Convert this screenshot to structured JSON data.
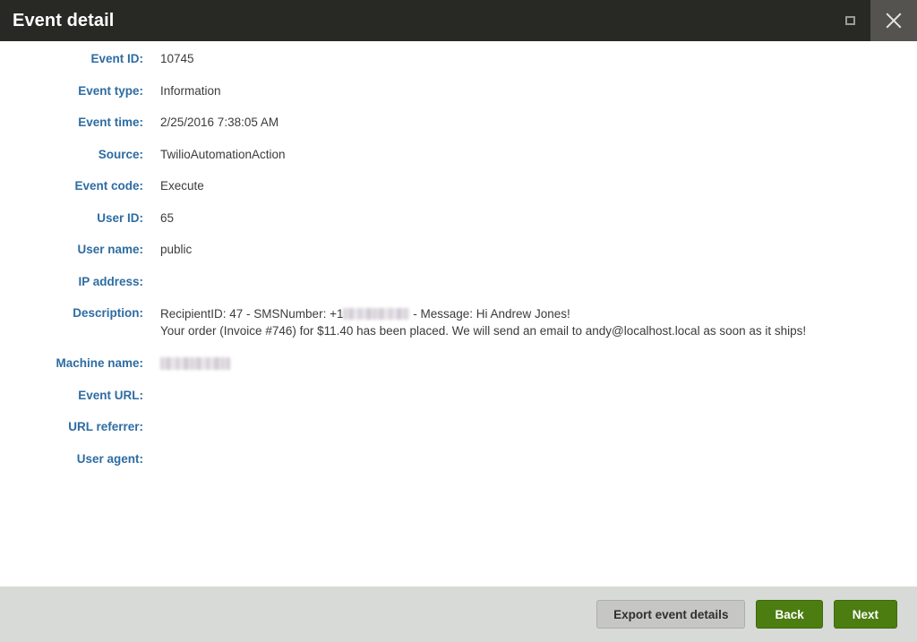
{
  "titlebar": {
    "title": "Event detail",
    "restore_icon": "restore-window-icon",
    "close_icon": "close-icon"
  },
  "fields": [
    {
      "label": "Event ID:",
      "value": "10745"
    },
    {
      "label": "Event type:",
      "value": "Information"
    },
    {
      "label": "Event time:",
      "value": "2/25/2016 7:38:05 AM"
    },
    {
      "label": "Source:",
      "value": "TwilioAutomationAction"
    },
    {
      "label": "Event code:",
      "value": "Execute"
    },
    {
      "label": "User ID:",
      "value": "65"
    },
    {
      "label": "User name:",
      "value": "public"
    },
    {
      "label": "IP address:",
      "value": ""
    },
    {
      "label": "Description:",
      "value": ""
    },
    {
      "label": "Machine name:",
      "value": ""
    },
    {
      "label": "Event URL:",
      "value": ""
    },
    {
      "label": "URL referrer:",
      "value": ""
    },
    {
      "label": "User agent:",
      "value": ""
    }
  ],
  "description": {
    "line1_before": "RecipientID: 47 - SMSNumber: +1",
    "line1_redacted": "redacted-phone-number",
    "line1_after": " - Message: Hi Andrew Jones!",
    "line2": "Your order (Invoice #746) for $11.40 has been placed. We will send an email to andy@localhost.local as soon as it ships!"
  },
  "machine_name": {
    "redacted": "redacted-machine-name"
  },
  "footer": {
    "export_label": "Export event details",
    "back_label": "Back",
    "next_label": "Next"
  },
  "colors": {
    "titlebar_bg": "#282825",
    "label_blue": "#2d6ca2",
    "footer_bg": "#d8dad7",
    "primary_green": "#4b7d10",
    "secondary_gray": "#c6c6c4"
  }
}
